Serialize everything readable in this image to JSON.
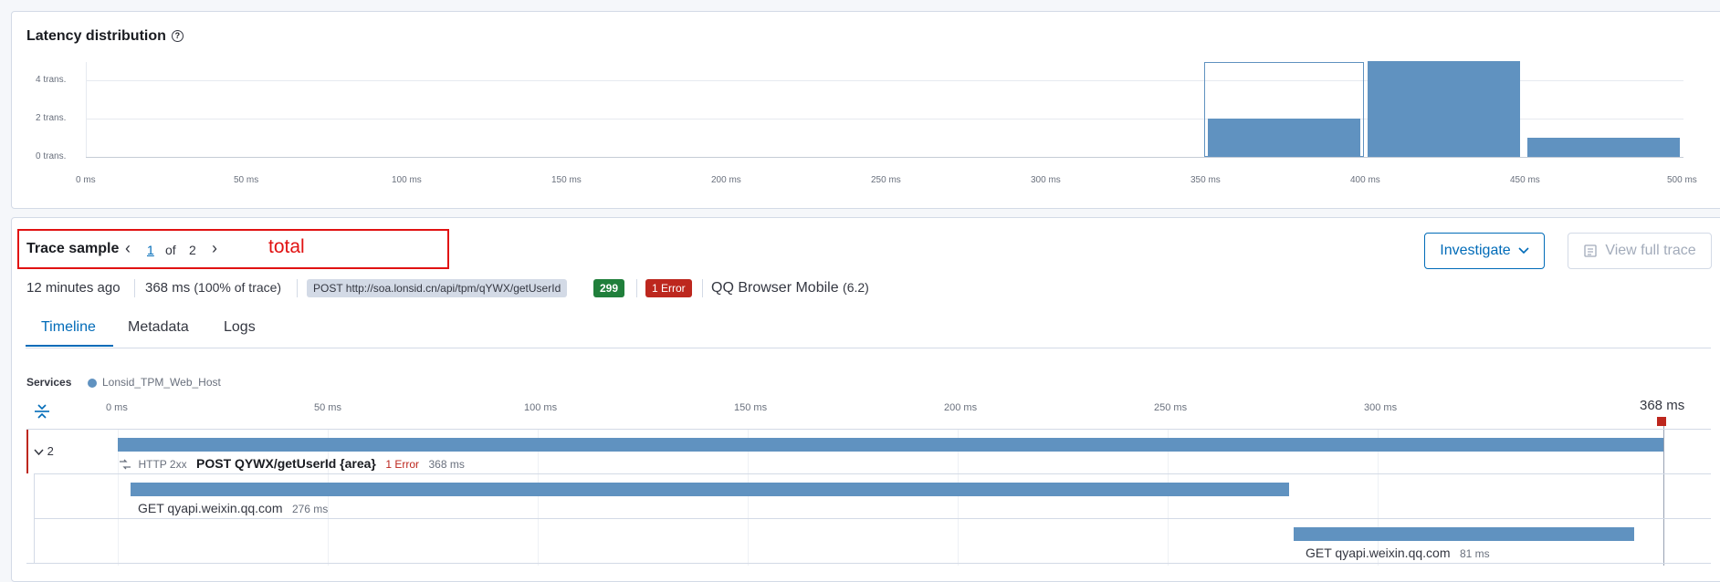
{
  "latency": {
    "title": "Latency distribution",
    "help_icon": "?",
    "y_ticks": [
      "4 trans.",
      "2 trans.",
      "0 trans."
    ],
    "x_ticks": [
      "0 ms",
      "50 ms",
      "100 ms",
      "150 ms",
      "200 ms",
      "250 ms",
      "300 ms",
      "350 ms",
      "400 ms",
      "450 ms",
      "500 ms"
    ]
  },
  "chart_data": {
    "type": "bar",
    "title": "Latency distribution",
    "xlabel": "",
    "ylabel": "",
    "x_unit": "ms",
    "y_unit": "trans.",
    "xlim": [
      0,
      500
    ],
    "ylim": [
      0,
      5
    ],
    "bins": [
      {
        "start": 350,
        "end": 400,
        "value": 2,
        "selected": true
      },
      {
        "start": 400,
        "end": 450,
        "value": 5,
        "selected": false
      },
      {
        "start": 450,
        "end": 500,
        "value": 1,
        "selected": false
      }
    ],
    "grid": true,
    "color": "#6092c0"
  },
  "trace": {
    "title": "Trace sample",
    "pager": {
      "prev": "‹",
      "current": "1",
      "of": "of",
      "total": "2",
      "next": "›"
    },
    "annotation": "total",
    "investigate_label": "Investigate",
    "view_full_trace_label": "View full trace",
    "time_ago": "12 minutes ago",
    "duration": "368 ms",
    "duration_pct": "(100% of trace)",
    "request": "POST http://soa.lonsid.cn/api/tpm/qYWX/getUserId",
    "status_code": "299",
    "errors": "1 Error",
    "agent": "QQ Browser Mobile",
    "agent_version": "(6.2)"
  },
  "tabs": [
    {
      "label": "Timeline",
      "active": true
    },
    {
      "label": "Metadata",
      "active": false
    },
    {
      "label": "Logs",
      "active": false
    }
  ],
  "timeline": {
    "services_label": "Services",
    "service_name": "Lonsid_TPM_Web_Host",
    "ticks": [
      "0 ms",
      "50 ms",
      "100 ms",
      "150 ms",
      "200 ms",
      "250 ms",
      "300 ms"
    ],
    "end_marker": "368 ms",
    "total_ms": 368,
    "spans": [
      {
        "toggle": "2",
        "http_status": "HTTP 2xx",
        "name": "POST QYWX/getUserId {area}",
        "error": "1 Error",
        "duration": "368 ms",
        "start_ms": 0,
        "duration_ms": 368
      },
      {
        "name": "GET qyapi.weixin.qq.com",
        "duration": "276 ms",
        "start_ms": 3,
        "duration_ms": 276
      },
      {
        "name": "GET qyapi.weixin.qq.com",
        "duration": "81 ms",
        "start_ms": 280,
        "duration_ms": 81
      }
    ]
  },
  "colors": {
    "accent": "#006bb8",
    "bar": "#6092c0",
    "success": "#207f3b",
    "danger": "#bd271e",
    "highlight": "#e11212"
  }
}
